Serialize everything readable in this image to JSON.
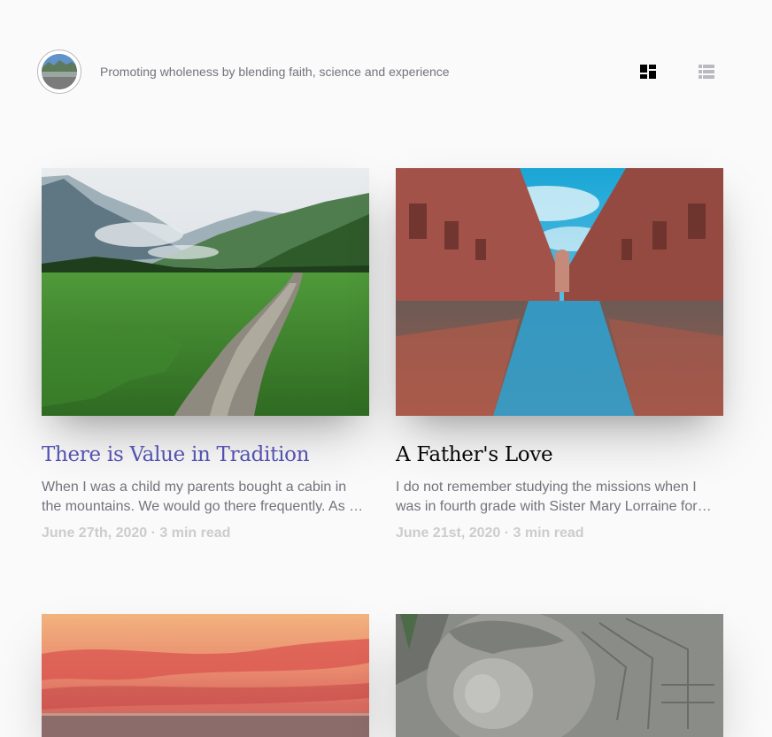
{
  "header": {
    "tagline": "Promoting wholeness by blending faith, science and experience"
  },
  "posts": [
    {
      "title": "There is Value in Tradition",
      "excerpt": "When I was a child my parents bought a cabin in the mountains. We would go there frequently. As a child I loved the mountains and the cabin.",
      "date": "June 27th, 2020",
      "separator": "·",
      "read_time": "3 min read",
      "image": "mountain-path-photo"
    },
    {
      "title": "A Father's Love",
      "excerpt": "I do not remember studying the missions when I was in fourth grade with Sister Mary Lorraine for that school year.",
      "date": "June 21st, 2020",
      "separator": "·",
      "read_time": "3 min read",
      "image": "city-street-reflection-photo"
    },
    {
      "image": "sunset-ocean-photo"
    },
    {
      "image": "stone-carving-photo"
    }
  ],
  "colors": {
    "background": "#fafafa",
    "accent": "#5452b0",
    "title": "#08080b",
    "body_text": "#73737d",
    "meta_text": "#cccccc"
  },
  "icons": {
    "grid_toggle": "grid-view-icon",
    "rows_toggle": "list-view-icon"
  }
}
